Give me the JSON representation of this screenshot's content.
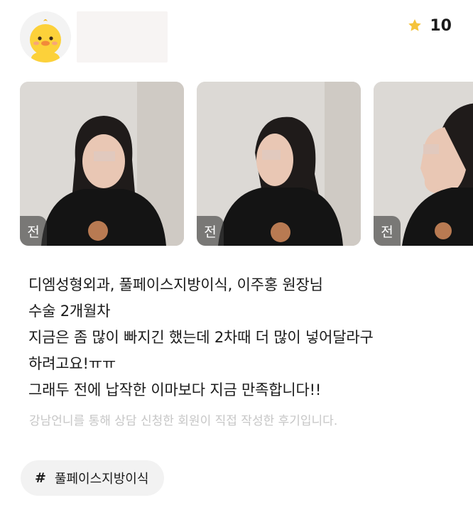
{
  "user": {
    "avatar_icon": "duck-avatar-icon"
  },
  "rating": {
    "icon": "star-icon",
    "value": "10",
    "color": "#f5c33b"
  },
  "photos": [
    {
      "badge": "전",
      "view": "front"
    },
    {
      "badge": "전",
      "view": "three-quarter"
    },
    {
      "badge": "전",
      "view": "profile"
    }
  ],
  "review": {
    "lines": [
      "디엠성형외과, 풀페이스지방이식, 이주홍 원장님",
      "수술 2개월차",
      "지금은 좀 많이 빠지긴 했는데 2차때 더 많이 넣어달라구",
      "하려고요!ㅠㅠ",
      "그래두 전에 납작한 이마보다 지금 만족합니다!!"
    ],
    "note": "강남언니를 통해 상담 신청한 회원이 직접 작성한 후기입니다."
  },
  "tag": {
    "hash": "#",
    "label": "풀페이스지방이식"
  }
}
